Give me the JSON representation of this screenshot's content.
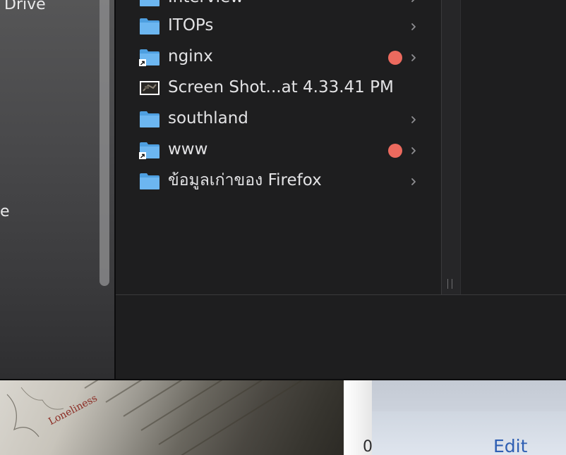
{
  "sidebar": {
    "items": [
      {
        "label": "Drive"
      },
      {
        "label": "e"
      }
    ]
  },
  "files": [
    {
      "name": "Interview",
      "kind": "folder",
      "alias": false,
      "tag_color": null,
      "has_children": true
    },
    {
      "name": "ITOPs",
      "kind": "folder",
      "alias": false,
      "tag_color": null,
      "has_children": true
    },
    {
      "name": "nginx",
      "kind": "folder",
      "alias": true,
      "tag_color": "#ec6a5e",
      "has_children": true
    },
    {
      "name": "Screen Shot...at 4.33.41 PM",
      "kind": "image",
      "alias": false,
      "tag_color": null,
      "has_children": false
    },
    {
      "name": "southland",
      "kind": "folder",
      "alias": false,
      "tag_color": null,
      "has_children": true
    },
    {
      "name": "www",
      "kind": "folder",
      "alias": true,
      "tag_color": "#ec6a5e",
      "has_children": true
    },
    {
      "name": "ข้อมูลเก่าของ Firefox",
      "kind": "folder",
      "alias": false,
      "tag_color": null,
      "has_children": true
    }
  ],
  "background": {
    "photo_text": "Loneliness",
    "other_window_partial": "0",
    "edit_label": "Edit"
  },
  "colors": {
    "folder_blue": "#5aaae8",
    "tag_red": "#ec6a5e",
    "link_blue": "#2f5fb3"
  }
}
